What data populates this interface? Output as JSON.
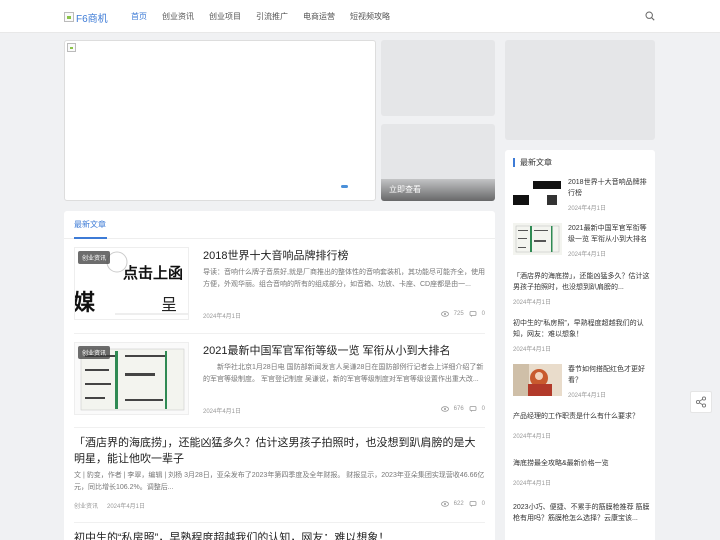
{
  "header": {
    "logo_text": "F6商机",
    "nav": [
      "首页",
      "创业资讯",
      "创业项目",
      "引流推广",
      "电商运营",
      "短视频攻略"
    ]
  },
  "slider": {
    "caption": "立即查看"
  },
  "main": {
    "section_title": "最新文章",
    "articles": [
      {
        "badge": "创业资讯",
        "title": "2018世界十大音响品牌排行榜",
        "desc": "导读：音响什么牌子音质好,就是厂商推出的整体性的音响套装机，其功能尽可能齐全，使用方便，外观华丽。组合音响的所有的组成部分，如音箱、功放、卡座、CD座都是由一...",
        "date": "2024年4月1日",
        "views": "725",
        "comments": "0",
        "thumb_text_1": "点击上函",
        "thumb_text_2": "媒",
        "thumb_text_3": "呈"
      },
      {
        "badge": "创业资讯",
        "title": "2021最新中国军官军衔等级一览 军衔从小到大排名",
        "desc": "新华社北京1月28日电 国防部新闻发言人吴谦28日在国防部例行记者会上详细介绍了新的军官等级制度。 军官登记制度 吴谦说，新的军官等级制度对军官等级设置作出重大改...",
        "date": "2024年4月1日",
        "views": "676",
        "comments": "0"
      },
      {
        "title": "「酒店界的海底捞」，还能凶猛多久？估计这男孩子拍照时，也没想到趴肩膀的是大明星，能让他吹一辈子",
        "desc": "文 | 豹变，作者 | 李翠，编辑 | 刘杨 3月28日，亚朵发布了2023年第四季度及全年财报。 财报显示，2023年亚朵集团实现营收46.66亿元，同比增长106.2%。调整后...",
        "category": "创业资讯",
        "date": "2024年4月1日",
        "views": "622",
        "comments": "0"
      },
      {
        "title": "初中生的“私房照”，早熟程度超越我们的认知，网友：难以想象！"
      }
    ]
  },
  "sidebar": {
    "title": "最新文章",
    "items": [
      {
        "text": "2018世界十大音响品牌排行榜",
        "date": "2024年4月1日"
      },
      {
        "text": "2021最新中国军官军衔等级一览 军衔从小到大排名",
        "date": "2024年4月1日"
      },
      {
        "text": "「酒店界的海底捞」，还能凶猛多久？估计这男孩子拍照时，也没想到趴肩膀的...",
        "date": "2024年4月1日"
      },
      {
        "text": "初中生的“私房照”，早熟程度超越我们的认知，网友：难以想象！",
        "date": "2024年4月1日"
      },
      {
        "text": "春节如何搭配红色才更好看？",
        "date": "2024年4月1日"
      },
      {
        "text": "产品经理的工作职责是什么有什么要求？",
        "date": "2024年4月1日"
      },
      {
        "text": "海底捞最全攻略&最新价格一览",
        "date": "2024年4月1日"
      },
      {
        "text": "2023小巧、便捷、不累手的筋膜枪推荐 筋膜枪有用吗？筋膜枪怎么选择？云康宝该...",
        "date": ""
      }
    ]
  },
  "icons": {
    "search": "search-icon",
    "share": "share-icon",
    "views": "eye-icon",
    "comments": "comment-icon"
  },
  "colors": {
    "accent": "#3d7bd6",
    "background": "#f0f1f3"
  }
}
